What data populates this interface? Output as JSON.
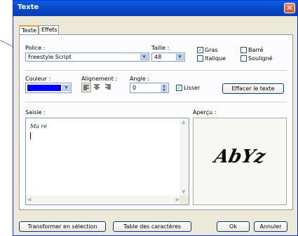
{
  "window": {
    "title": "Texte"
  },
  "tabs": [
    {
      "label": "Texte"
    },
    {
      "label": "Effets"
    }
  ],
  "font": {
    "label": "Police :",
    "value": "Freestyle Script"
  },
  "size": {
    "label": "Taille :",
    "value": "48"
  },
  "style": {
    "bold": {
      "label": "Gras",
      "checked": true
    },
    "italic": {
      "label": "Italique",
      "checked": false
    },
    "strike": {
      "label": "Barré",
      "checked": false
    },
    "underline": {
      "label": "Souligné",
      "checked": false
    }
  },
  "color": {
    "label": "Couleur :",
    "value": "#0000ff"
  },
  "alignment": {
    "label": "Alignement :",
    "selected": "left"
  },
  "angle": {
    "label": "Angle :",
    "value": "0"
  },
  "smooth": {
    "label": "Lisser",
    "checked": true
  },
  "clear_button": "Effacer le texte",
  "input": {
    "label": "Saisie :",
    "value": "Ma ré"
  },
  "preview": {
    "label": "Aperçu :",
    "text": "AbYz"
  },
  "buttons": {
    "to_selection": "Transformer en sélection",
    "char_table": "Table des caractères",
    "ok": "Ok",
    "cancel": "Annuler"
  }
}
